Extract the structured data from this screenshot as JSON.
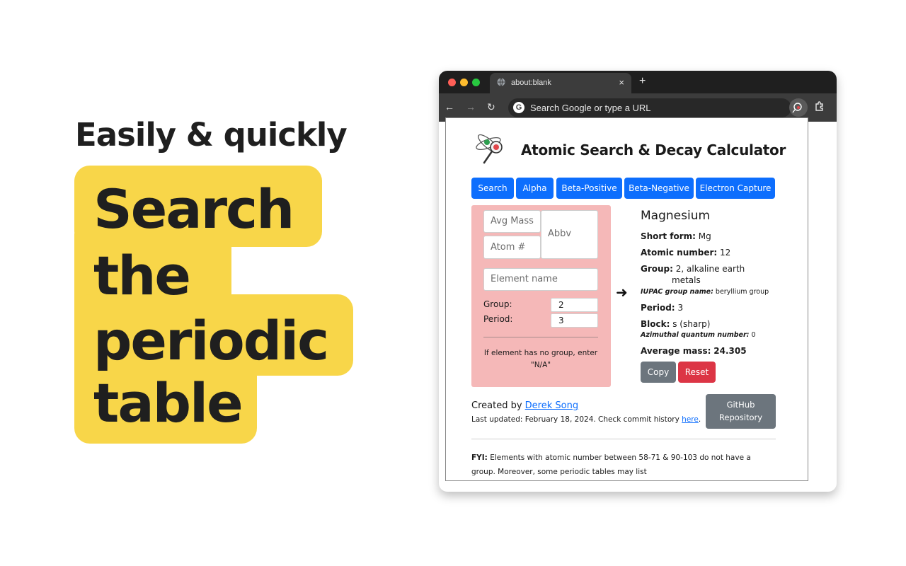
{
  "promo": {
    "subhead": "Easily & quickly",
    "line1": "Search",
    "line2": "the",
    "line3": "periodic",
    "line4": "table",
    "highlight_color": "#f8d649"
  },
  "browser": {
    "tab_title": "about:blank",
    "tab_close": "×",
    "new_tab": "+",
    "back": "←",
    "forward": "→",
    "reload": "↻",
    "omnibox_g": "G",
    "omnibox_placeholder": "Search Google or type a URL"
  },
  "app": {
    "title": "Atomic Search & Decay Calculator",
    "mode_buttons": [
      "Search",
      "Alpha",
      "Beta-Positive",
      "Beta-Negative",
      "Electron Capture"
    ],
    "inputs": {
      "avg_mass_placeholder": "Avg Mass",
      "abbv_placeholder": "Abbv",
      "atom_num_placeholder": "Atom #",
      "element_name_placeholder": "Element name",
      "group_label": "Group:",
      "group_value": "2",
      "period_label": "Period:",
      "period_value": "3",
      "note": "If element has no group, enter \"N/A\""
    },
    "arrow": "➜",
    "result": {
      "element_name": "Magnesium",
      "short_form_label": "Short form:",
      "short_form_value": "Mg",
      "atomic_number_label": "Atomic number:",
      "atomic_number_value": "12",
      "group_label": "Group:",
      "group_value": "2, alkaline earth",
      "group_value_cont": "metals",
      "iupac_label": "IUPAC group name:",
      "iupac_value": "beryllium group",
      "period_label": "Period:",
      "period_value": "3",
      "block_label": "Block:",
      "block_value": "s (sharp)",
      "azimuthal_label": "Azimuthal quantum number:",
      "azimuthal_value": "0",
      "avg_mass_label": "Average mass:",
      "avg_mass_value": "24.305",
      "copy_label": "Copy",
      "reset_label": "Reset"
    },
    "footer": {
      "created_by": "Created by",
      "author": "Derek Song",
      "updated_prefix": "Last updated: February 18, 2024. Check commit history",
      "here": "here",
      "updated_suffix": ".",
      "github_line1": "GitHub",
      "github_line2": "Repository",
      "fyi_label": "FYI:",
      "fyi_text": "Elements with atomic number between 58-71 & 90-103 do not have a group. Moreover, some periodic tables may list"
    },
    "colors": {
      "primary": "#0d6efd",
      "secondary": "#6c757d",
      "danger": "#dc3545",
      "search_panel": "#f5b8b8"
    }
  }
}
